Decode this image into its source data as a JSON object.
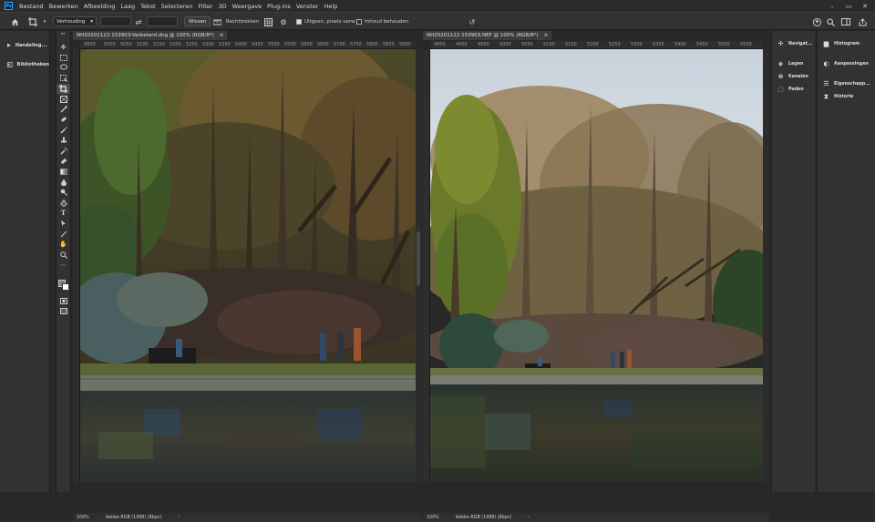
{
  "menubar": {
    "logo": "Ps",
    "items": [
      "Bestand",
      "Bewerken",
      "Afbeelding",
      "Laag",
      "Tekst",
      "Selecteren",
      "Filter",
      "3D",
      "Weergave",
      "Plug-ins",
      "Venster",
      "Help"
    ],
    "window_controls": [
      "–",
      "▭",
      "✕"
    ]
  },
  "options": {
    "ratio_select": "Verhouding",
    "swap_icon_glyph": "⇄",
    "clear_button": "Wissen",
    "straighten_label": "Rechttrekken",
    "delete_cropped_label": "Uitgesn. pixels verw.",
    "delete_cropped_checked": true,
    "content_aware_label": "Inhoud behouden",
    "content_aware_checked": false
  },
  "left_panel": {
    "items": [
      {
        "icon": "play-icon",
        "label": "Handeling..."
      },
      {
        "icon": "library-icon",
        "label": "Bibliotheken"
      }
    ]
  },
  "tools": [
    "move",
    "marquee",
    "lasso",
    "object-select",
    "crop",
    "frame",
    "eyedropper",
    "spot-heal",
    "brush",
    "stamp",
    "history-brush",
    "eraser",
    "gradient",
    "blur",
    "dodge",
    "pen",
    "type",
    "path-select",
    "rectangle",
    "hand",
    "zoom",
    "more"
  ],
  "documents": [
    {
      "tab_title": "NH20201122-153903-Verbeterd.dng @ 100% (RGB/8*)",
      "close_glyph": "×",
      "ruler_ticks": [
        "9950",
        "5000",
        "5050",
        "5100",
        "5150",
        "5200",
        "5250",
        "5300",
        "5350",
        "5400",
        "5450",
        "5500",
        "5550",
        "5600",
        "5650",
        "5700",
        "5750",
        "5800",
        "5850",
        "5900"
      ],
      "zoom": "100%",
      "profile": "Adobe RGB (1998) (8bpc)",
      "arrow": "›"
    },
    {
      "tab_title": "NH20201122-153903.NEF @ 100% (RGB/8*)",
      "close_glyph": "×",
      "ruler_ticks": [
        "4850",
        "4900",
        "4950",
        "5000",
        "5050",
        "5100",
        "5150",
        "5200",
        "5250",
        "5300",
        "5350",
        "5400",
        "5450",
        "5500",
        "5550"
      ],
      "zoom": "100%",
      "profile": "Adobe RGB (1998) (8bpc)",
      "arrow": "›"
    }
  ],
  "right_dock_1": {
    "items": [
      {
        "icon": "navigator-icon",
        "label": "Navigat..."
      },
      {
        "icon": "layers-icon",
        "label": "Lagen"
      },
      {
        "icon": "channels-icon",
        "label": "Kanalen"
      },
      {
        "icon": "paths-icon",
        "label": "Paden"
      }
    ]
  },
  "right_dock_2": {
    "items": [
      {
        "icon": "histogram-icon",
        "label": "Histogram"
      },
      {
        "icon": "adjustments-icon",
        "label": "Aanpassingen"
      },
      {
        "icon": "properties-icon",
        "label": "Eigenschapp..."
      },
      {
        "icon": "history-icon",
        "label": "Historie"
      }
    ]
  },
  "colors": {
    "app_bg": "#282828",
    "panel_bg": "#323232",
    "accent": "#31a8ff"
  }
}
